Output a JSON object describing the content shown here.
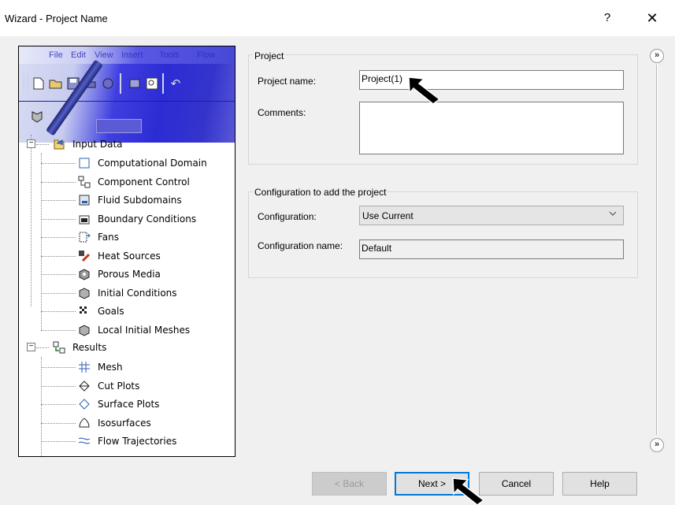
{
  "window": {
    "title": "Wizard - Project Name",
    "help_label": "?",
    "close_label": "✕"
  },
  "illustration": {
    "menu": [
      "File",
      "Edit",
      "View",
      "Insert",
      "Tools",
      "Flow"
    ],
    "tree": {
      "input_data": {
        "label": "Input Data",
        "children": [
          {
            "label": "Computational Domain",
            "icon": "computational-domain-icon"
          },
          {
            "label": "Component Control",
            "icon": "component-control-icon"
          },
          {
            "label": "Fluid Subdomains",
            "icon": "fluid-subdomains-icon"
          },
          {
            "label": "Boundary Conditions",
            "icon": "boundary-conditions-icon"
          },
          {
            "label": "Fans",
            "icon": "fans-icon"
          },
          {
            "label": "Heat Sources",
            "icon": "heat-sources-icon"
          },
          {
            "label": "Porous Media",
            "icon": "porous-media-icon"
          },
          {
            "label": "Initial Conditions",
            "icon": "initial-conditions-icon"
          },
          {
            "label": "Goals",
            "icon": "goals-icon"
          },
          {
            "label": "Local Initial Meshes",
            "icon": "local-initial-meshes-icon"
          }
        ]
      },
      "results": {
        "label": "Results",
        "children": [
          {
            "label": "Mesh",
            "icon": "mesh-icon"
          },
          {
            "label": "Cut Plots",
            "icon": "cut-plots-icon"
          },
          {
            "label": "Surface Plots",
            "icon": "surface-plots-icon"
          },
          {
            "label": "Isosurfaces",
            "icon": "isosurfaces-icon"
          },
          {
            "label": "Flow Trajectories",
            "icon": "flow-trajectories-icon"
          }
        ]
      }
    }
  },
  "project_group": {
    "legend": "Project",
    "project_name_label": "Project name:",
    "project_name_value": "Project(1)",
    "comments_label": "Comments:",
    "comments_value": ""
  },
  "configuration_group": {
    "legend": "Configuration to add the project",
    "configuration_label": "Configuration:",
    "configuration_value": "Use Current",
    "configuration_name_label": "Configuration name:",
    "configuration_name_value": "Default"
  },
  "buttons": {
    "back": "< Back",
    "next": "Next >",
    "cancel": "Cancel",
    "help": "Help"
  },
  "side": {
    "expand_top": "»",
    "expand_bottom": "»"
  }
}
